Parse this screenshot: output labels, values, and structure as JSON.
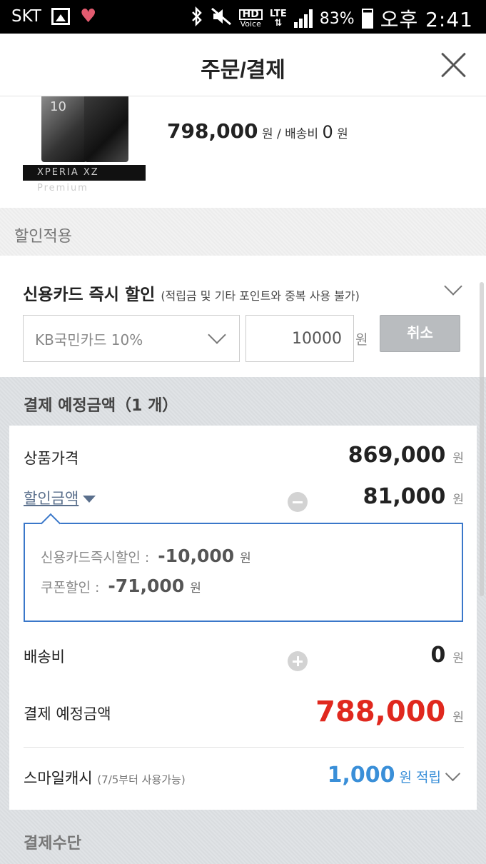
{
  "status_bar": {
    "carrier": "SKT",
    "hd_label": "HD",
    "voice_label": "Voice",
    "network": "LTE",
    "battery": "83%",
    "time": "오후 2:41"
  },
  "header": {
    "title": "주문/결제"
  },
  "product": {
    "brand_text": "XPERIA XZ Premium",
    "screen_text": "10",
    "price": "798,000",
    "price_unit": "원",
    "shipping_label": "/ 배송비",
    "shipping_value": "0",
    "shipping_unit": "원"
  },
  "discount_section": {
    "title": "할인적용",
    "card_title": "신용카드 즉시 할인",
    "card_note": "(적립금 및 기타 포인트와 중복 사용 불가)",
    "card_select_value": "KB국민카드 10%",
    "amount_value": "10000",
    "amount_unit": "원",
    "cancel_label": "취소"
  },
  "summary": {
    "title": "결제 예정금액（1 개）",
    "rows": {
      "product_price_label": "상품가격",
      "product_price_value": "869,000",
      "discount_label": "할인금액",
      "discount_value": "81,000",
      "shipping_label": "배송비",
      "shipping_value": "0",
      "total_label": "결제 예정금액",
      "total_value": "788,000",
      "smile_label": "스마일캐시",
      "smile_note": "(7/5부터 사용가능)",
      "smile_value": "1,000",
      "smile_unit": "원 적립",
      "unit": "원"
    },
    "discount_details": [
      {
        "label": "신용카드즉시할인 :",
        "value": "-10,000",
        "unit": "원"
      },
      {
        "label": "쿠폰할인 :",
        "value": "-71,000",
        "unit": "원"
      }
    ]
  },
  "payment_method": {
    "title": "결제수단"
  },
  "colors": {
    "total_red": "#e0281e",
    "smile_blue": "#3a8fd8",
    "detail_border_blue": "#3a77c9"
  }
}
